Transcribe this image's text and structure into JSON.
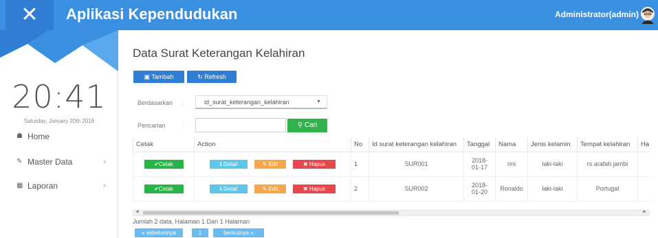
{
  "header": {
    "close_glyph": "✕",
    "title": "Aplikasi Kependudukan",
    "user": "Administrator(admin)"
  },
  "sidebar": {
    "time": "20:41",
    "date": "Saturday, January 20th 2018",
    "items": [
      {
        "label": "Home",
        "icon": "home-icon"
      },
      {
        "label": "Master Data",
        "icon": "edit-icon",
        "chevron": "›"
      },
      {
        "label": "Laporan",
        "icon": "table-icon",
        "chevron": "›"
      }
    ]
  },
  "main": {
    "title": "Data Surat Keterangan Kelahiran",
    "buttons": {
      "add": "Tambah",
      "refresh": "Refresh"
    },
    "filter": {
      "by_label": "Berdasarkan",
      "colon": ":",
      "selected_field": "id_surat_keterangan_kelahiran",
      "search_label": "Pencarian",
      "search_value": "",
      "search_button": "Cari"
    },
    "table": {
      "headers": [
        "Cetak",
        "Action",
        "No",
        "Id surat keterangan kelahiran",
        "Tanggal",
        "Nama",
        "Jenis kelamin",
        "Tempat kelahiran",
        "Ha"
      ],
      "action_labels": {
        "print": "Cetak",
        "detail": "Detail",
        "edit": "Edit",
        "delete": "Hapus"
      },
      "rows": [
        {
          "no": "1",
          "id": "SUR001",
          "tanggal_1": "2018-",
          "tanggal_2": "01-17",
          "nama": "rini",
          "jenis_kelamin": "laki-laki",
          "tempat": "rs arafah jambi"
        },
        {
          "no": "2",
          "id": "SUR002",
          "tanggal_1": "2018-",
          "tanggal_2": "01-20",
          "nama": "Ronaldo",
          "jenis_kelamin": "laki-laki",
          "tempat": "Portugal"
        }
      ]
    },
    "summary": "Jumlah 2 data, Halaman 1 Dari 1 Halaman",
    "pagination": {
      "prev": "« sebelumnya",
      "page": "1",
      "next": "berikutnya »"
    }
  },
  "colors": {
    "brand": "#3b8fe0",
    "success": "#28b548",
    "info": "#5ec6ea",
    "warning": "#f6a64c",
    "danger": "#e8484d"
  }
}
